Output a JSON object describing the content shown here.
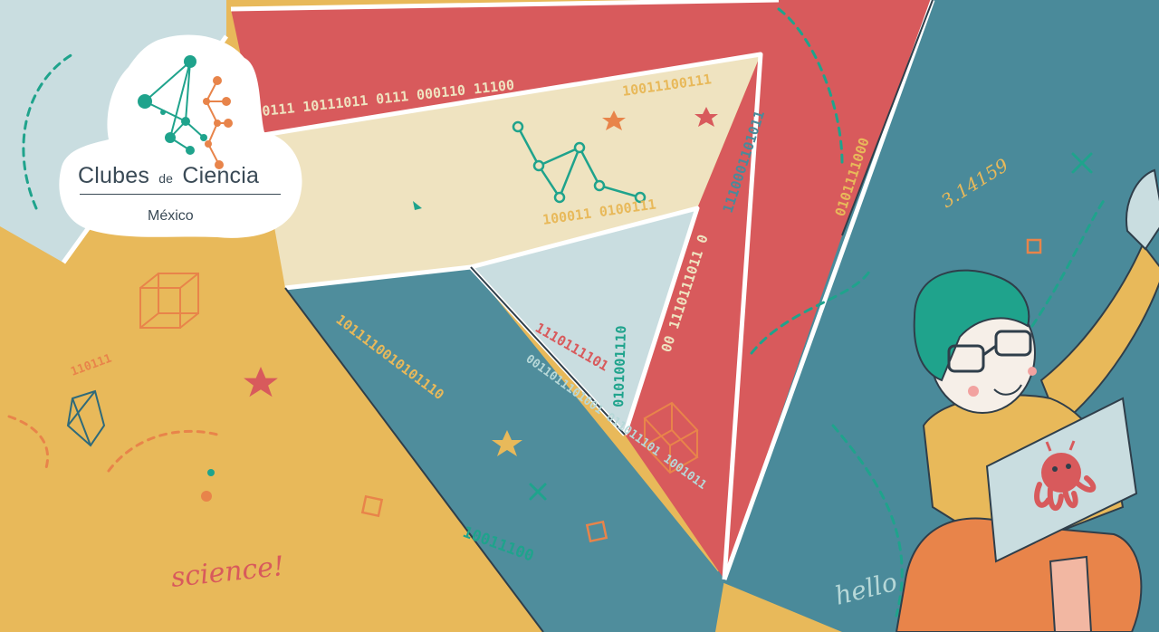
{
  "logo": {
    "title_part1": "Clubes",
    "title_small": "de",
    "title_part2": "Ciencia",
    "subtitle": "México"
  },
  "scribbles": {
    "science": "science!",
    "hello": "hello",
    "pi": "3.14159",
    "binary": {
      "red_top": "0111 10111011 0111 000110 11100",
      "cream_top": "10011100111",
      "cream_bottom": "100011 0100111",
      "red_right": "1110001101011",
      "red_right2": "00 1110111011 0",
      "red_right3": "0101111000",
      "blue_left": "1011110010101110",
      "center_col": "0101001110",
      "center_red": "1110111101",
      "center_diag": "0011011101001 011011101 1001011",
      "bottom": "10011100",
      "small": "110111"
    }
  },
  "colors": {
    "red": "#d85a5c",
    "teal_blue": "#4a8a9a",
    "yellow": "#e8b95a",
    "cream": "#efe3c0",
    "pale_blue": "#c9dde0",
    "accent_teal": "#1fa38c",
    "accent_orange": "#e8844a"
  },
  "icons": [
    "cube-icon",
    "star-icon",
    "molecule-icon",
    "octopus-icon",
    "laptop-icon",
    "atom-logo-icon"
  ]
}
